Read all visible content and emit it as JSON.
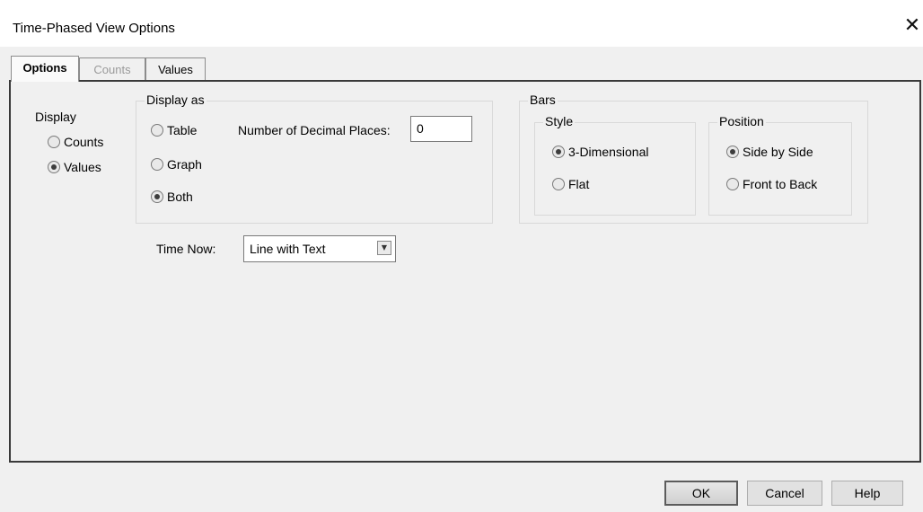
{
  "window": {
    "title": "Time-Phased View Options",
    "close_glyph": "✕"
  },
  "tabs": [
    {
      "label": "Options",
      "state": "active"
    },
    {
      "label": "Counts",
      "state": "disabled"
    },
    {
      "label": "Values",
      "state": "normal"
    }
  ],
  "display": {
    "label": "Display",
    "options": [
      {
        "label": "Counts",
        "selected": false
      },
      {
        "label": "Values",
        "selected": true
      }
    ]
  },
  "display_as": {
    "legend": "Display as",
    "options": [
      {
        "label": "Table",
        "selected": false
      },
      {
        "label": "Graph",
        "selected": false
      },
      {
        "label": "Both",
        "selected": true
      }
    ],
    "decimal_label": "Number of Decimal Places:",
    "decimal_value": "0"
  },
  "bars": {
    "legend": "Bars",
    "style": {
      "legend": "Style",
      "options": [
        {
          "label": "3-Dimensional",
          "selected": true
        },
        {
          "label": "Flat",
          "selected": false
        }
      ]
    },
    "position": {
      "legend": "Position",
      "options": [
        {
          "label": "Side by Side",
          "selected": true
        },
        {
          "label": "Front to Back",
          "selected": false
        }
      ]
    }
  },
  "time_now": {
    "label": "Time Now:",
    "value": "Line with Text",
    "icon": "chevron-down-icon"
  },
  "buttons": {
    "ok": "OK",
    "cancel": "Cancel",
    "help": "Help"
  }
}
